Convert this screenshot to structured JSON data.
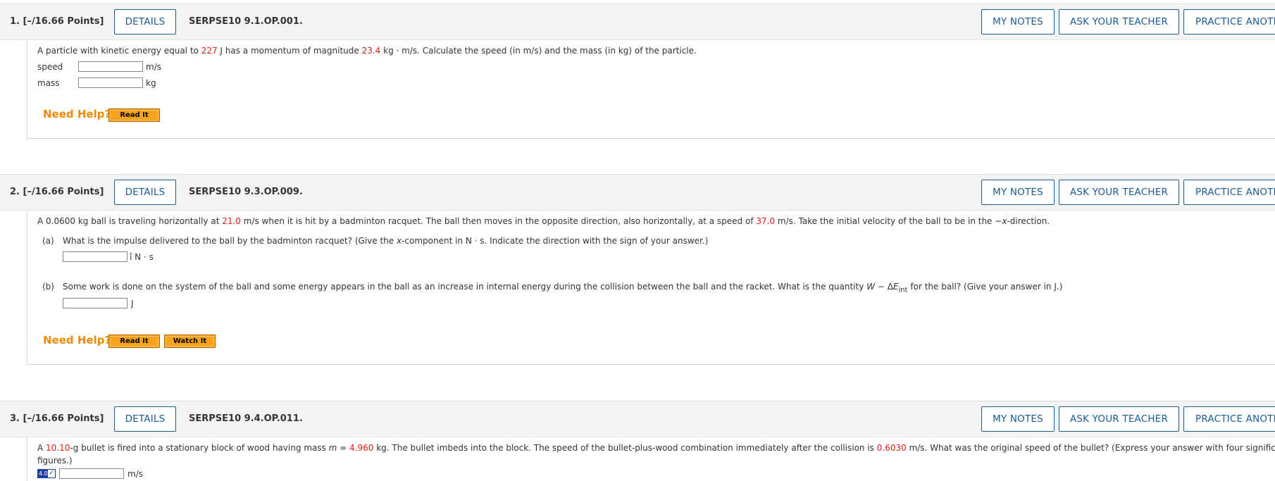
{
  "common": {
    "details_label": "DETAILS",
    "my_notes_label": "MY NOTES",
    "ask_teacher_label": "ASK YOUR TEACHER",
    "practice_label": "PRACTICE ANOTHER",
    "need_help": "Need Help?",
    "read_it": "Read It",
    "watch_it": "Watch It"
  },
  "q1": {
    "number": "1. [–/16.66 Points]",
    "code": "SERPSE10 9.1.OP.001.",
    "text_a": "A particle with kinetic energy equal to ",
    "ke": "227",
    "text_b": " J has a momentum of magnitude ",
    "p": "23.4",
    "text_c": " kg · m/s. Calculate the speed (in m/s) and the mass (in kg) of the particle.",
    "speed_label": "speed",
    "speed_unit": "m/s",
    "speed_value": "",
    "mass_label": "mass",
    "mass_unit": "kg",
    "mass_value": ""
  },
  "q2": {
    "number": "2. [–/16.66 Points]",
    "code": "SERPSE10 9.3.OP.009.",
    "text_a": "A 0.0600 kg ball is traveling horizontally at ",
    "v1": "21.0",
    "text_b": " m/s when it is hit by a badminton racquet. The ball then moves in the opposite direction, also horizontally, at a speed of ",
    "v2": "37.0",
    "text_c": " m/s. Take the initial velocity of the ball to be in the −",
    "text_c_x": "x",
    "text_c_end": "-direction.",
    "part_a_label": "(a)",
    "part_a_text1": "What is the impulse delivered to the ball by the badminton racquet? (Give the ",
    "part_a_x": "x",
    "part_a_text2": "-component in N · s. Indicate the direction with the sign of your answer.)",
    "part_a_unit": "î N · s",
    "part_a_value": "",
    "part_b_label": "(b)",
    "part_b_text1": "Some work is done on the system of the ball and some energy appears in the ball as an increase in internal energy during the collision between the ball and the racket. What is the quantity ",
    "part_b_w": "W",
    "part_b_minus": " − Δ",
    "part_b_e": "E",
    "part_b_sub": "int",
    "part_b_text2": " for the ball? (Give your answer in J.)",
    "part_b_unit": "J",
    "part_b_value": ""
  },
  "q3": {
    "number": "3. [–/16.66 Points]",
    "code": "SERPSE10 9.4.OP.011.",
    "text_a": "A ",
    "m1": "10.10",
    "text_b": "-g bullet is fired into a stationary block of wood having mass ",
    "m_var": "m",
    "text_c": " = ",
    "m2": "4.960",
    "text_d": " kg. The bullet imbeds into the block. The speed of the bullet-plus-wood combination immediately after the collision is ",
    "v": "0.6030",
    "text_e": " m/s. What was the original speed of the bullet? (Express your answer with four significant",
    "text_f": "figures.)",
    "badge": "4.0",
    "check": "✓",
    "unit": "m/s",
    "value": ""
  },
  "colors": {
    "accent": "#1a5b96",
    "given_value": "#e0201a",
    "help": "#f08a00",
    "help_button": "#f9a31b"
  }
}
